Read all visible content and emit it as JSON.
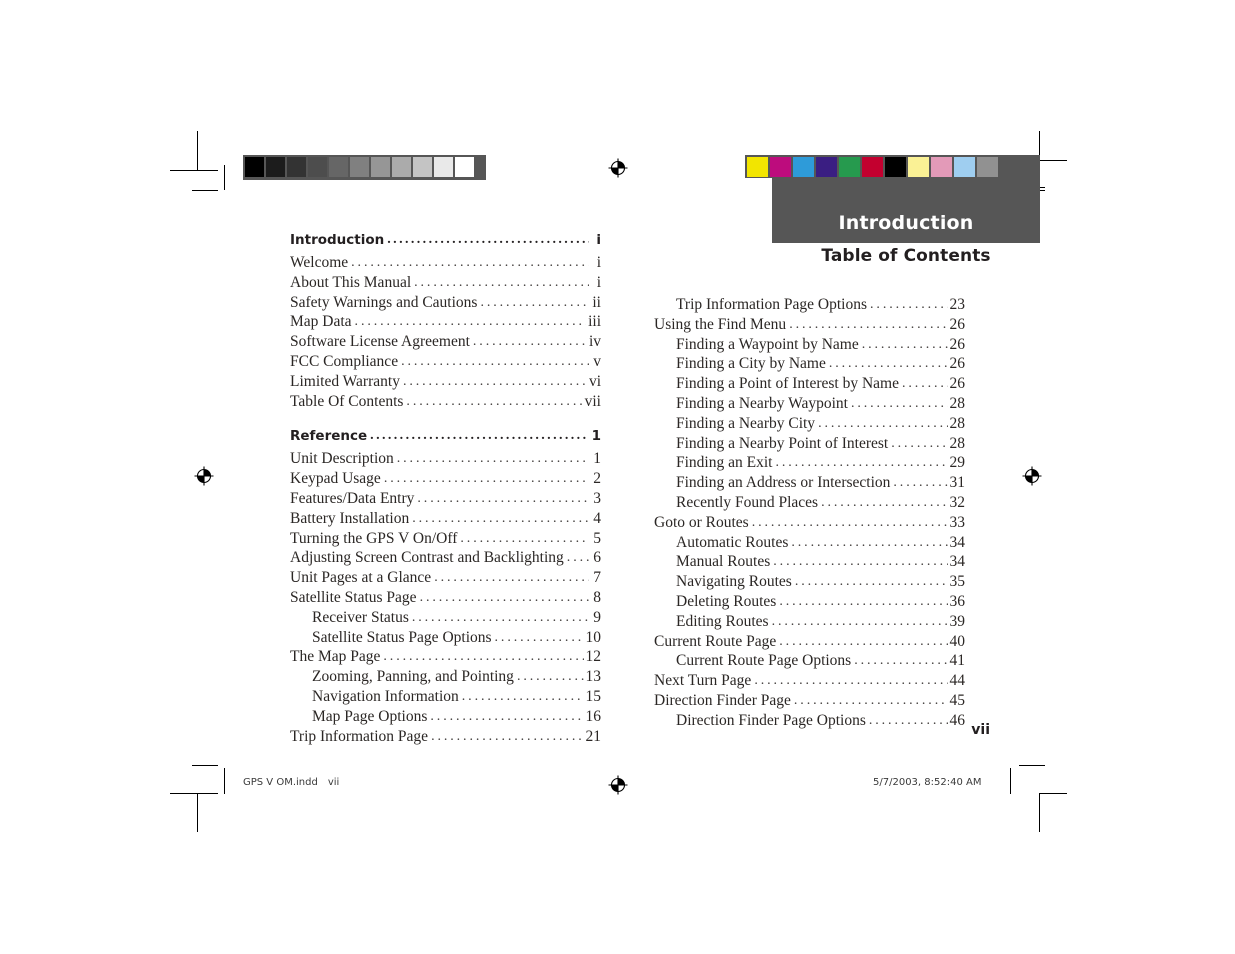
{
  "document": {
    "section_tab_label": "Introduction",
    "toc_title": "Table of Contents",
    "folio": "vii"
  },
  "imposition": {
    "file_name": "GPS V OM.indd",
    "file_page": "vii",
    "timestamp": "5/7/2003, 8:52:40 AM"
  },
  "calibration": {
    "grayscale_label": "grayscale-calibration-bar",
    "grayscale_swatches": [
      "#000000",
      "#1c1c1c",
      "#333333",
      "#4d4d4d",
      "#666666",
      "#808080",
      "#969696",
      "#ababab",
      "#c4c4c4",
      "#e9e9e9",
      "#ffffff"
    ],
    "color_label": "color-calibration-bar",
    "color_swatches": [
      "#f2e500",
      "#bd0c7d",
      "#2e9bd9",
      "#3a1e82",
      "#269a4e",
      "#c3002f",
      "#000000",
      "#faf195",
      "#e39ab8",
      "#9fcef0",
      "#919191"
    ]
  },
  "toc_left": [
    {
      "level": "head",
      "text": "Introduction",
      "page": "i"
    },
    {
      "level": "lvl1",
      "text": "Welcome",
      "page": "i"
    },
    {
      "level": "lvl1",
      "text": "About This Manual",
      "page": "i"
    },
    {
      "level": "lvl1",
      "text": "Safety Warnings and Cautions",
      "page": "ii"
    },
    {
      "level": "lvl1",
      "text": "Map Data",
      "page": "iii"
    },
    {
      "level": "lvl1",
      "text": "Software License Agreement",
      "page": "iv"
    },
    {
      "level": "lvl1",
      "text": "FCC Compliance",
      "page": "v"
    },
    {
      "level": "lvl1",
      "text": "Limited Warranty",
      "page": "vi"
    },
    {
      "level": "lvl1",
      "text": "Table Of Contents",
      "page": "vii"
    },
    {
      "level": "spacer",
      "text": "",
      "page": ""
    },
    {
      "level": "head",
      "text": "Reference",
      "page": "1"
    },
    {
      "level": "lvl1",
      "text": "Unit Description",
      "page": "1"
    },
    {
      "level": "lvl1",
      "text": "Keypad Usage",
      "page": "2"
    },
    {
      "level": "lvl1",
      "text": "Features/Data Entry",
      "page": "3"
    },
    {
      "level": "lvl1",
      "text": "Battery Installation",
      "page": "4"
    },
    {
      "level": "lvl1",
      "text": "Turning the GPS V On/Off",
      "page": "5"
    },
    {
      "level": "lvl1",
      "text": "Adjusting Screen Contrast and Backlighting",
      "page": "6"
    },
    {
      "level": "lvl1",
      "text": "Unit Pages at a Glance",
      "page": "7"
    },
    {
      "level": "lvl1",
      "text": "Satellite Status Page",
      "page": "8"
    },
    {
      "level": "lvl2",
      "text": "Receiver Status",
      "page": "9"
    },
    {
      "level": "lvl2",
      "text": "Satellite Status Page Options",
      "page": "10"
    },
    {
      "level": "lvl1",
      "text": "The Map Page",
      "page": "12"
    },
    {
      "level": "lvl2",
      "text": "Zooming, Panning, and Pointing",
      "page": "13"
    },
    {
      "level": "lvl2",
      "text": "Navigation Information",
      "page": "15"
    },
    {
      "level": "lvl2",
      "text": "Map Page Options",
      "page": "16"
    },
    {
      "level": "lvl1",
      "text": "Trip Information Page",
      "page": "21"
    }
  ],
  "toc_right": [
    {
      "level": "lvl2",
      "text": "Trip Information Page Options",
      "page": "23"
    },
    {
      "level": "lvl1",
      "text": "Using the Find Menu",
      "page": "26"
    },
    {
      "level": "lvl2",
      "text": "Finding a Waypoint by Name",
      "page": "26"
    },
    {
      "level": "lvl2",
      "text": "Finding a City by Name",
      "page": "26"
    },
    {
      "level": "lvl2",
      "text": "Finding a Point of Interest by Name",
      "page": "26"
    },
    {
      "level": "lvl2",
      "text": "Finding a Nearby Waypoint",
      "page": "28"
    },
    {
      "level": "lvl2",
      "text": "Finding a Nearby City",
      "page": "28"
    },
    {
      "level": "lvl2",
      "text": "Finding a Nearby Point of Interest",
      "page": "28"
    },
    {
      "level": "lvl2",
      "text": "Finding an Exit",
      "page": "29"
    },
    {
      "level": "lvl2",
      "text": "Finding an Address or Intersection",
      "page": "31"
    },
    {
      "level": "lvl2",
      "text": "Recently Found Places",
      "page": "32"
    },
    {
      "level": "lvl1",
      "text": "Goto or Routes",
      "page": "33"
    },
    {
      "level": "lvl2",
      "text": "Automatic Routes",
      "page": "34"
    },
    {
      "level": "lvl2",
      "text": "Manual Routes",
      "page": "34"
    },
    {
      "level": "lvl2",
      "text": "Navigating Routes",
      "page": "35"
    },
    {
      "level": "lvl2",
      "text": "Deleting Routes",
      "page": "36"
    },
    {
      "level": "lvl2",
      "text": "Editing Routes",
      "page": "39"
    },
    {
      "level": "lvl1",
      "text": "Current Route Page",
      "page": "40"
    },
    {
      "level": "lvl2",
      "text": "Current Route Page Options",
      "page": "41"
    },
    {
      "level": "lvl1",
      "text": "Next Turn Page",
      "page": "44"
    },
    {
      "level": "lvl1",
      "text": "Direction Finder Page",
      "page": "45"
    },
    {
      "level": "lvl2",
      "text": "Direction Finder Page Options",
      "page": "46"
    }
  ]
}
